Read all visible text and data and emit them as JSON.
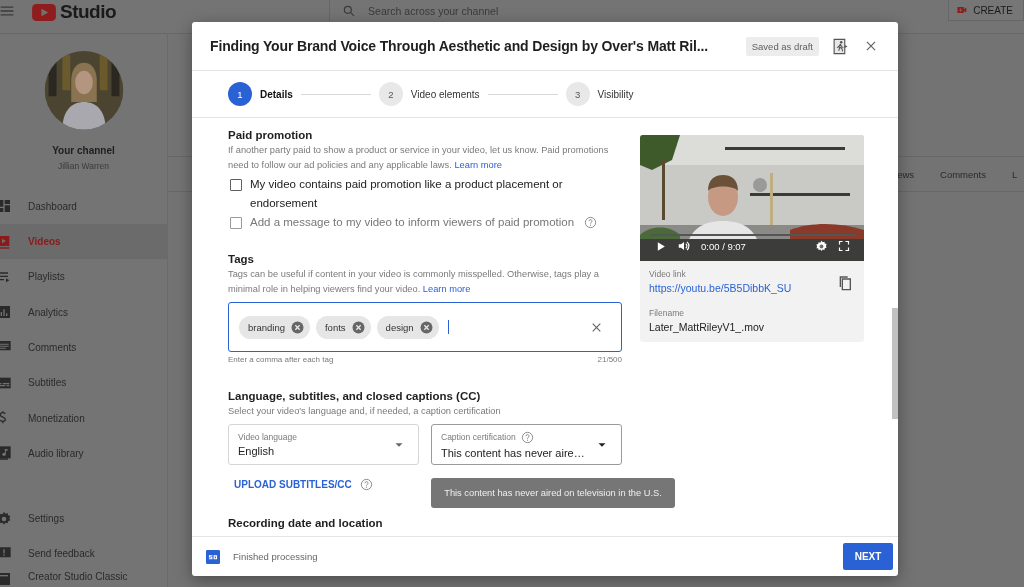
{
  "topbar": {
    "logo": "Studio",
    "search": {
      "placeholder": "Search across your channel"
    },
    "create_button": "CREATE"
  },
  "sidebar": {
    "channel_title": "Your channel",
    "channel_name": "Jillian Warren",
    "items": [
      {
        "label": "Dashboard",
        "kind": "dashboard",
        "selected": false
      },
      {
        "label": "Videos",
        "kind": "videos",
        "selected": true
      },
      {
        "label": "Playlists",
        "kind": "playlists",
        "selected": false
      },
      {
        "label": "Analytics",
        "kind": "analytics",
        "selected": false
      },
      {
        "label": "Comments",
        "kind": "comments",
        "selected": false
      },
      {
        "label": "Subtitles",
        "kind": "subtitles",
        "selected": false
      },
      {
        "label": "Monetization",
        "kind": "monetization",
        "selected": false
      },
      {
        "label": "Audio library",
        "kind": "audio",
        "selected": false
      }
    ],
    "footer_items": [
      {
        "label": "Settings",
        "kind": "settings"
      },
      {
        "label": "Send feedback",
        "kind": "feedback"
      },
      {
        "label": "Creator Studio Classic",
        "kind": "classic"
      }
    ]
  },
  "background_table": {
    "columns": [
      "ews",
      "Comments",
      "L"
    ]
  },
  "dialog": {
    "title": "Finding Your Brand Voice Through Aesthetic and Design by Over's Matt Ril...",
    "draft_badge": "Saved as draft",
    "steps": [
      {
        "number": "1",
        "label": "Details",
        "selected": true
      },
      {
        "number": "2",
        "label": "Video elements",
        "selected": false
      },
      {
        "number": "3",
        "label": "Visibility",
        "selected": false
      }
    ],
    "paid_promotion": {
      "heading": "Paid promotion",
      "description": "If another party paid to show a product or service in your video, let us know. Paid promotions need to follow our ad policies and any applicable laws.",
      "link": "Learn more",
      "checkboxes": [
        {
          "label": "My video contains paid promotion like a product placement or endorsement",
          "checked": false,
          "disabled": false,
          "help": false
        },
        {
          "label": "Add a message to my video to inform viewers of paid promotion",
          "checked": false,
          "disabled": true,
          "help": true
        }
      ]
    },
    "tags": {
      "heading": "Tags",
      "description": "Tags can be useful if content in your video is commonly misspelled. Otherwise, tags play a minimal role in helping viewers find your video.",
      "link": "Learn more",
      "chips": [
        "branding",
        "fonts",
        "design"
      ],
      "hint": "Enter a comma after each tag",
      "counter": "21/500"
    },
    "language": {
      "heading": "Language, subtitles, and closed captions (CC)",
      "description": "Select your video's language and, if needed, a caption certification",
      "fields": [
        {
          "label": "Video language",
          "value": "English",
          "help": false
        },
        {
          "label": "Caption certification",
          "value": "This content has never aire…",
          "help": true
        }
      ],
      "upload_link": "UPLOAD SUBTITLES/CC",
      "tooltip": "This content has never aired on television in the U.S."
    },
    "recording": {
      "heading": "Recording date and location"
    },
    "preview": {
      "time": "0:00 / 9:07",
      "link_label": "Video link",
      "link": "https://youtu.be/5B5DibbK_SU",
      "filename_label": "Filename",
      "filename": "Later_MattRileyV1_.mov"
    },
    "footer": {
      "status": "Finished processing",
      "next_button": "NEXT"
    }
  }
}
